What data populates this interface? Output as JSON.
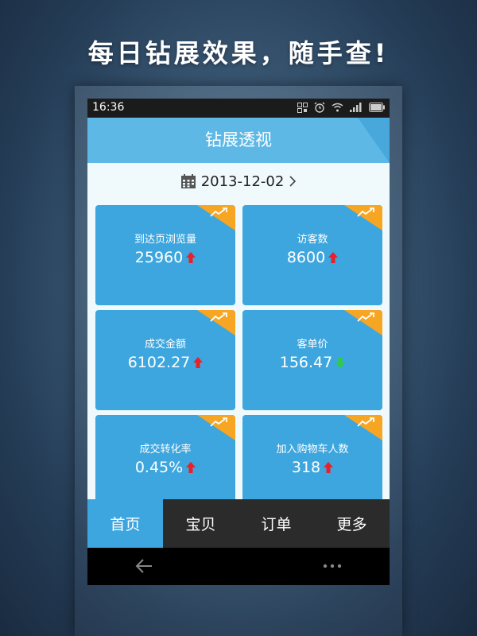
{
  "promo_text": "每日钻展效果，随手查!",
  "status_bar": {
    "time": "16:36"
  },
  "header": {
    "title": "钻展透视"
  },
  "date": {
    "value": "2013-12-02"
  },
  "cards": [
    {
      "label": "到达页浏览量",
      "value": "25960",
      "trend": "up"
    },
    {
      "label": "访客数",
      "value": "8600",
      "trend": "up"
    },
    {
      "label": "成交金额",
      "value": "6102.27",
      "trend": "up"
    },
    {
      "label": "客单价",
      "value": "156.47",
      "trend": "down"
    },
    {
      "label": "成交转化率",
      "value": "0.45%",
      "trend": "up"
    },
    {
      "label": "加入购物车人数",
      "value": "318",
      "trend": "up"
    }
  ],
  "tabs": [
    {
      "label": "首页",
      "active": true
    },
    {
      "label": "宝贝",
      "active": false
    },
    {
      "label": "订单",
      "active": false
    },
    {
      "label": "更多",
      "active": false
    }
  ],
  "colors": {
    "card": "#3ea6de",
    "header": "#5db8e6",
    "corner": "#f6a623",
    "trend_up": "#e8202a",
    "trend_down": "#2ecc40"
  }
}
